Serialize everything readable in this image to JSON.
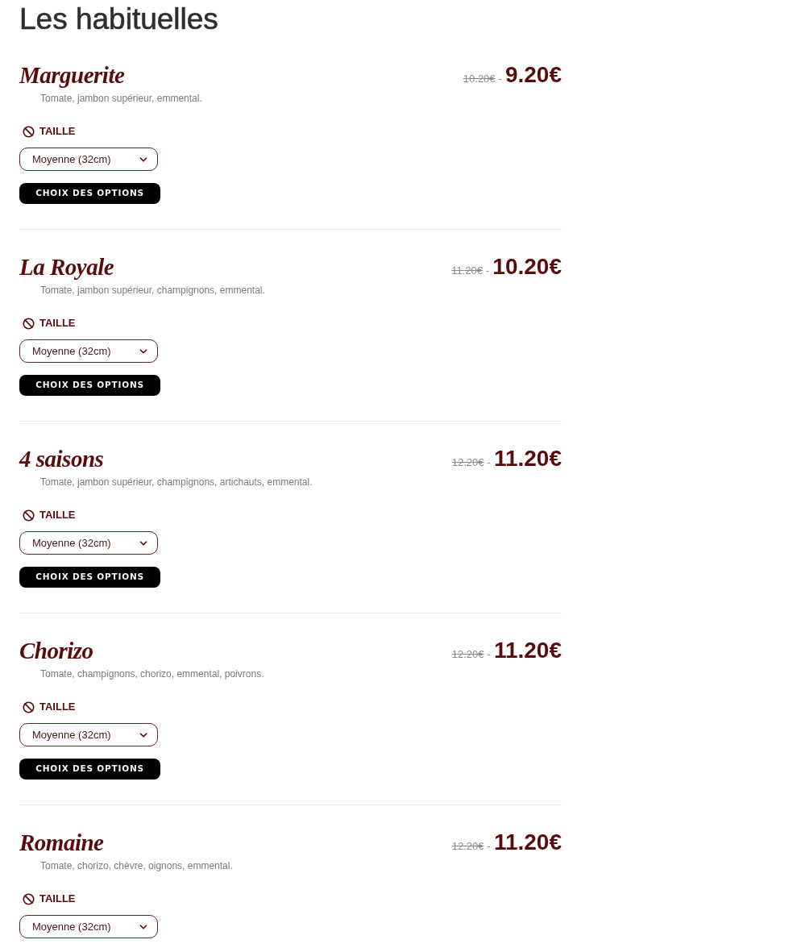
{
  "section": {
    "title": "Les habituelles"
  },
  "items": [
    {
      "name": "Marguerite",
      "old_price": "10.20€",
      "separator": "-",
      "price": "9.20€",
      "ingredients": "Tomate, jambon supérieur, emmental.",
      "size_label": "TAILLE",
      "size_value": "Moyenne (32cm)",
      "options_button": "CHOIX DES OPTIONS"
    },
    {
      "name": "La Royale",
      "old_price": "11.20€",
      "separator": "-",
      "price": "10.20€",
      "ingredients": "Tomate, jambon supérieur, champignons, emmental.",
      "size_label": "TAILLE",
      "size_value": "Moyenne (32cm)",
      "options_button": "CHOIX DES OPTIONS"
    },
    {
      "name": "4 saisons",
      "old_price": "12.20€",
      "separator": "-",
      "price": "11.20€",
      "ingredients": "Tomate, jambon supérieur, champignons, artichauts, emmental.",
      "size_label": "TAILLE",
      "size_value": "Moyenne (32cm)",
      "options_button": "CHOIX DES OPTIONS"
    },
    {
      "name": "Chorizo",
      "old_price": "12.20€",
      "separator": "-",
      "price": "11.20€",
      "ingredients": "Tomate, champignons, chorizo, emmental, poivrons.",
      "size_label": "TAILLE",
      "size_value": "Moyenne (32cm)",
      "options_button": "CHOIX DES OPTIONS"
    },
    {
      "name": "Romaine",
      "old_price": "12.20€",
      "separator": "-",
      "price": "11.20€",
      "ingredients": "Tomate, chorizo, chèvre, oignons, emmental.",
      "size_label": "TAILLE",
      "size_value": "Moyenne (32cm)"
    }
  ]
}
